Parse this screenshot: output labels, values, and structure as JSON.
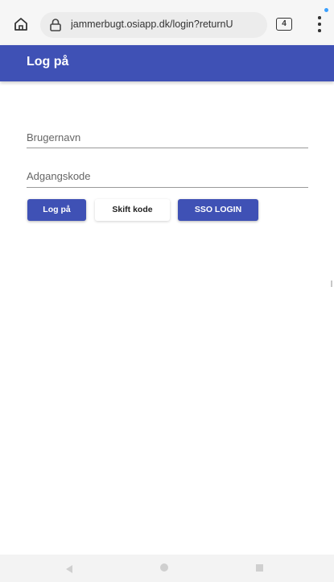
{
  "browser": {
    "url": "jammerbugt.osiapp.dk/login?returnU",
    "tab_count": "4",
    "icons": {
      "home": "home-icon",
      "lock": "lock-icon",
      "menu": "more-vert-icon"
    }
  },
  "appbar": {
    "title": "Log på",
    "color": "#3f51b5"
  },
  "form": {
    "username": {
      "label": "Brugernavn",
      "value": ""
    },
    "password": {
      "label": "Adgangskode",
      "value": ""
    }
  },
  "buttons": {
    "login": "Log på",
    "change_password": "Skift kode",
    "sso": "SSO LOGIN"
  },
  "navbar": {
    "icons": [
      "back-icon",
      "home-icon",
      "recents-icon"
    ]
  }
}
